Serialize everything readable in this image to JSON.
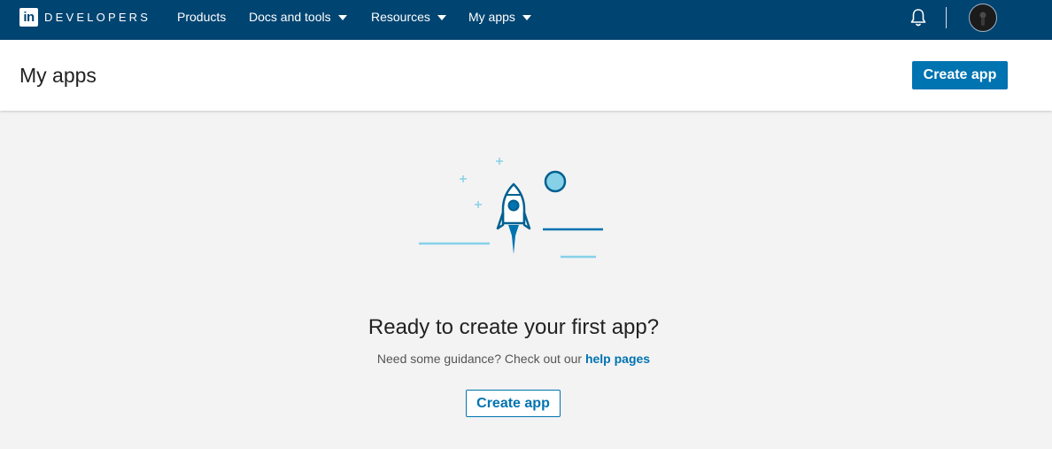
{
  "topnav": {
    "logo_text": "in",
    "brand": "DEVELOPERS",
    "items": [
      {
        "label": "Products",
        "has_dropdown": false
      },
      {
        "label": "Docs and tools",
        "has_dropdown": true
      },
      {
        "label": "Resources",
        "has_dropdown": true
      },
      {
        "label": "My apps",
        "has_dropdown": true
      }
    ],
    "icons": [
      "bell-icon",
      "avatar"
    ]
  },
  "header": {
    "title": "My apps",
    "create_button": "Create app"
  },
  "empty_state": {
    "illustration": "rocket-illustration",
    "title": "Ready to create your first app?",
    "subtitle_prefix": "Need some guidance? Check out our",
    "help_link": "help pages",
    "create_button": "Create app"
  },
  "colors": {
    "nav_bg": "#004471",
    "accent": "#0073b1",
    "page_bg": "#f3f3f3",
    "illustration_light": "#86d1e8"
  }
}
